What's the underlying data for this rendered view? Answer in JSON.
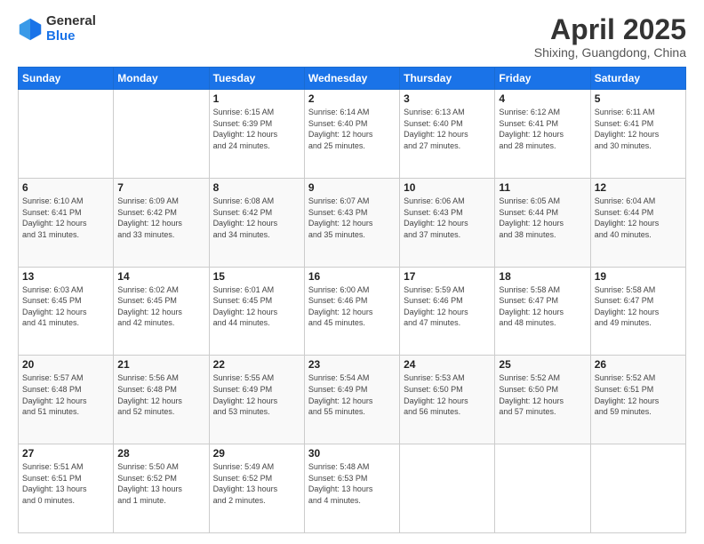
{
  "logo": {
    "general": "General",
    "blue": "Blue"
  },
  "header": {
    "month": "April 2025",
    "location": "Shixing, Guangdong, China"
  },
  "weekdays": [
    "Sunday",
    "Monday",
    "Tuesday",
    "Wednesday",
    "Thursday",
    "Friday",
    "Saturday"
  ],
  "weeks": [
    [
      {
        "day": "",
        "info": ""
      },
      {
        "day": "",
        "info": ""
      },
      {
        "day": "1",
        "info": "Sunrise: 6:15 AM\nSunset: 6:39 PM\nDaylight: 12 hours\nand 24 minutes."
      },
      {
        "day": "2",
        "info": "Sunrise: 6:14 AM\nSunset: 6:40 PM\nDaylight: 12 hours\nand 25 minutes."
      },
      {
        "day": "3",
        "info": "Sunrise: 6:13 AM\nSunset: 6:40 PM\nDaylight: 12 hours\nand 27 minutes."
      },
      {
        "day": "4",
        "info": "Sunrise: 6:12 AM\nSunset: 6:41 PM\nDaylight: 12 hours\nand 28 minutes."
      },
      {
        "day": "5",
        "info": "Sunrise: 6:11 AM\nSunset: 6:41 PM\nDaylight: 12 hours\nand 30 minutes."
      }
    ],
    [
      {
        "day": "6",
        "info": "Sunrise: 6:10 AM\nSunset: 6:41 PM\nDaylight: 12 hours\nand 31 minutes."
      },
      {
        "day": "7",
        "info": "Sunrise: 6:09 AM\nSunset: 6:42 PM\nDaylight: 12 hours\nand 33 minutes."
      },
      {
        "day": "8",
        "info": "Sunrise: 6:08 AM\nSunset: 6:42 PM\nDaylight: 12 hours\nand 34 minutes."
      },
      {
        "day": "9",
        "info": "Sunrise: 6:07 AM\nSunset: 6:43 PM\nDaylight: 12 hours\nand 35 minutes."
      },
      {
        "day": "10",
        "info": "Sunrise: 6:06 AM\nSunset: 6:43 PM\nDaylight: 12 hours\nand 37 minutes."
      },
      {
        "day": "11",
        "info": "Sunrise: 6:05 AM\nSunset: 6:44 PM\nDaylight: 12 hours\nand 38 minutes."
      },
      {
        "day": "12",
        "info": "Sunrise: 6:04 AM\nSunset: 6:44 PM\nDaylight: 12 hours\nand 40 minutes."
      }
    ],
    [
      {
        "day": "13",
        "info": "Sunrise: 6:03 AM\nSunset: 6:45 PM\nDaylight: 12 hours\nand 41 minutes."
      },
      {
        "day": "14",
        "info": "Sunrise: 6:02 AM\nSunset: 6:45 PM\nDaylight: 12 hours\nand 42 minutes."
      },
      {
        "day": "15",
        "info": "Sunrise: 6:01 AM\nSunset: 6:45 PM\nDaylight: 12 hours\nand 44 minutes."
      },
      {
        "day": "16",
        "info": "Sunrise: 6:00 AM\nSunset: 6:46 PM\nDaylight: 12 hours\nand 45 minutes."
      },
      {
        "day": "17",
        "info": "Sunrise: 5:59 AM\nSunset: 6:46 PM\nDaylight: 12 hours\nand 47 minutes."
      },
      {
        "day": "18",
        "info": "Sunrise: 5:58 AM\nSunset: 6:47 PM\nDaylight: 12 hours\nand 48 minutes."
      },
      {
        "day": "19",
        "info": "Sunrise: 5:58 AM\nSunset: 6:47 PM\nDaylight: 12 hours\nand 49 minutes."
      }
    ],
    [
      {
        "day": "20",
        "info": "Sunrise: 5:57 AM\nSunset: 6:48 PM\nDaylight: 12 hours\nand 51 minutes."
      },
      {
        "day": "21",
        "info": "Sunrise: 5:56 AM\nSunset: 6:48 PM\nDaylight: 12 hours\nand 52 minutes."
      },
      {
        "day": "22",
        "info": "Sunrise: 5:55 AM\nSunset: 6:49 PM\nDaylight: 12 hours\nand 53 minutes."
      },
      {
        "day": "23",
        "info": "Sunrise: 5:54 AM\nSunset: 6:49 PM\nDaylight: 12 hours\nand 55 minutes."
      },
      {
        "day": "24",
        "info": "Sunrise: 5:53 AM\nSunset: 6:50 PM\nDaylight: 12 hours\nand 56 minutes."
      },
      {
        "day": "25",
        "info": "Sunrise: 5:52 AM\nSunset: 6:50 PM\nDaylight: 12 hours\nand 57 minutes."
      },
      {
        "day": "26",
        "info": "Sunrise: 5:52 AM\nSunset: 6:51 PM\nDaylight: 12 hours\nand 59 minutes."
      }
    ],
    [
      {
        "day": "27",
        "info": "Sunrise: 5:51 AM\nSunset: 6:51 PM\nDaylight: 13 hours\nand 0 minutes."
      },
      {
        "day": "28",
        "info": "Sunrise: 5:50 AM\nSunset: 6:52 PM\nDaylight: 13 hours\nand 1 minute."
      },
      {
        "day": "29",
        "info": "Sunrise: 5:49 AM\nSunset: 6:52 PM\nDaylight: 13 hours\nand 2 minutes."
      },
      {
        "day": "30",
        "info": "Sunrise: 5:48 AM\nSunset: 6:53 PM\nDaylight: 13 hours\nand 4 minutes."
      },
      {
        "day": "",
        "info": ""
      },
      {
        "day": "",
        "info": ""
      },
      {
        "day": "",
        "info": ""
      }
    ]
  ]
}
